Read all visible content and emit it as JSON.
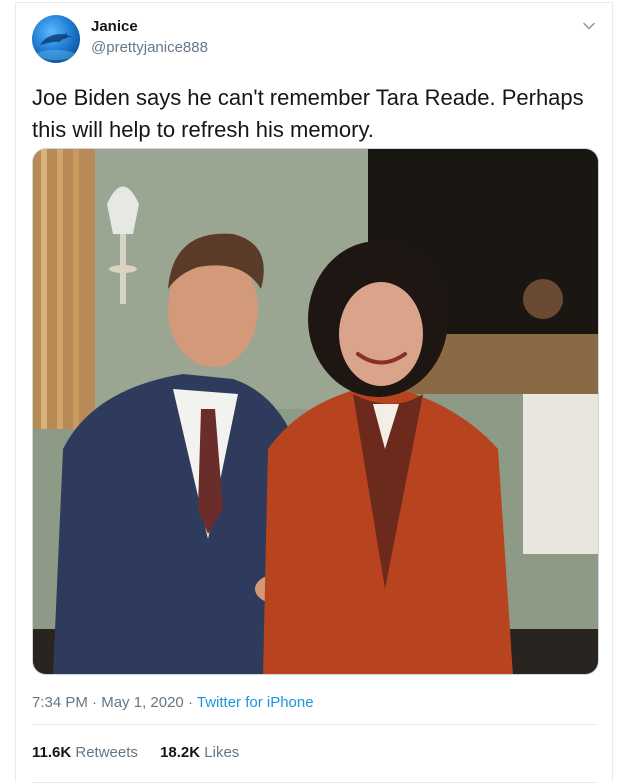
{
  "user": {
    "name": "Janice",
    "handle": "@prettyjanice888"
  },
  "tweet": {
    "text": "Joe Biden says he can't remember Tara Reade. Perhaps this will help to refresh his memory.",
    "time": "7:34 PM",
    "separator": "·",
    "date": "May 1, 2020",
    "source": "Twitter for iPhone"
  },
  "stats": {
    "retweets_count": "11.6K",
    "retweets_label": "Retweets",
    "likes_count": "18.2K",
    "likes_label": "Likes"
  },
  "colors": {
    "text": "#14171a",
    "secondary": "#657786",
    "link": "#1b95e0"
  },
  "icons": {
    "caret": "chevron-down-icon"
  }
}
